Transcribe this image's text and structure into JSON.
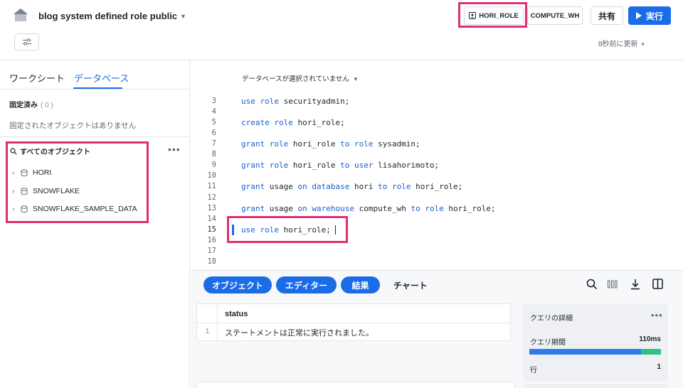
{
  "header": {
    "title": "blog system defined role public",
    "role_label": "HORI_ROLE",
    "warehouse_label": "COMPUTE_WH",
    "share_label": "共有",
    "run_label": "実行",
    "updated_label": "8秒前に更新"
  },
  "sidebar": {
    "tabs": [
      "ワークシート",
      "データベース"
    ],
    "active_tab": "データベース",
    "pinned_label": "固定済み",
    "pinned_count": "( 0 )",
    "pinned_empty": "固定されたオブジェクトはありません",
    "all_objects_label": "すべてのオブジェクト",
    "more_label": "•••",
    "databases": [
      "HORI",
      "SNOWFLAKE",
      "SNOWFLAKE_SAMPLE_DATA"
    ]
  },
  "editor": {
    "db_context": "データベースが選択されていません",
    "lines": [
      {
        "n": "3",
        "html": "<span class=\"kw\">use role</span> securityadmin;"
      },
      {
        "n": "4",
        "html": ""
      },
      {
        "n": "5",
        "html": "<span class=\"kw\">create role</span> hori_role;"
      },
      {
        "n": "6",
        "html": ""
      },
      {
        "n": "7",
        "html": "<span class=\"kw\">grant role</span> hori_role <span class=\"kw\">to role</span> sysadmin;"
      },
      {
        "n": "8",
        "html": ""
      },
      {
        "n": "9",
        "html": "<span class=\"kw\">grant role</span> hori_role <span class=\"kw\">to user</span> lisahorimoto;"
      },
      {
        "n": "10",
        "html": ""
      },
      {
        "n": "11",
        "html": "<span class=\"kw\">grant</span> usage <span class=\"kw\">on database</span> hori <span class=\"kw\">to role</span> hori_role;"
      },
      {
        "n": "12",
        "html": ""
      },
      {
        "n": "13",
        "html": "<span class=\"kw\">grant</span> usage <span class=\"kw\">on warehouse</span> compute_wh <span class=\"kw\">to role</span> hori_role;"
      },
      {
        "n": "14",
        "html": ""
      },
      {
        "n": "15",
        "html": "<span class=\"kw\">use role</span> hori_role;"
      },
      {
        "n": "16",
        "html": ""
      },
      {
        "n": "17",
        "html": ""
      },
      {
        "n": "18",
        "html": ""
      }
    ],
    "active_line": "15"
  },
  "bottom": {
    "tabs": [
      "オブジェクト",
      "エディター",
      "結果"
    ],
    "chart_tab": "チャート",
    "table": {
      "columns": [
        "status"
      ],
      "rows": [
        [
          "1",
          "ステートメントは正常に実行されました。"
        ]
      ]
    },
    "details": {
      "title": "クエリの詳細",
      "more": "•••",
      "duration_label": "クエリ期間",
      "duration_value": "110ms",
      "duration_fraction": 0.85,
      "rows_label": "行",
      "rows_value": "1"
    }
  },
  "colors": {
    "accent": "#1a6ce7",
    "highlight": "#de2f74",
    "keyword": "#1a5fd0",
    "duration_bar": "#2f7bea",
    "duration_rest": "#2ec27e"
  }
}
